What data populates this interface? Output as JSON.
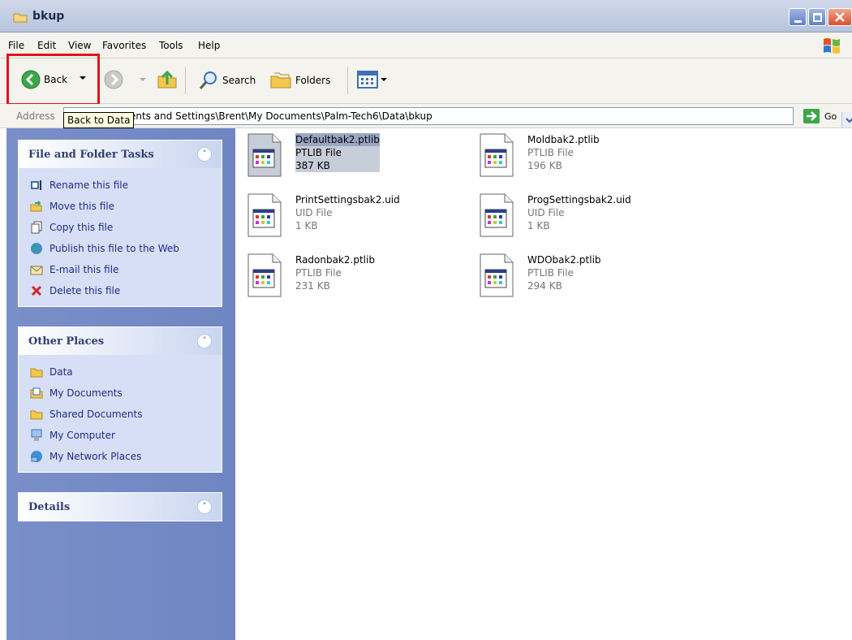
{
  "window": {
    "title": "bkup"
  },
  "menu": [
    "File",
    "Edit",
    "View",
    "Favorites",
    "Tools",
    "Help"
  ],
  "toolbar": {
    "back_label": "Back",
    "search_label": "Search",
    "folders_label": "Folders",
    "tooltip": "Back to Data"
  },
  "address": {
    "label": "Address",
    "value": "ents and Settings\\Brent\\My Documents\\Palm-Tech6\\Data\\bkup",
    "go_label": "Go"
  },
  "panels": {
    "file_tasks": {
      "title": "File and Folder Tasks",
      "items": [
        {
          "label": "Rename this file",
          "icon": "rename-icon"
        },
        {
          "label": "Move this file",
          "icon": "move-icon"
        },
        {
          "label": "Copy this file",
          "icon": "copy-icon"
        },
        {
          "label": "Publish this file to the Web",
          "icon": "globe-icon"
        },
        {
          "label": "E-mail this file",
          "icon": "email-icon"
        },
        {
          "label": "Delete this file",
          "icon": "delete-icon"
        }
      ]
    },
    "other_places": {
      "title": "Other Places",
      "items": [
        {
          "label": "Data",
          "icon": "folder-icon"
        },
        {
          "label": "My Documents",
          "icon": "documents-folder-icon"
        },
        {
          "label": "Shared Documents",
          "icon": "folder-icon"
        },
        {
          "label": "My Computer",
          "icon": "computer-icon"
        },
        {
          "label": "My Network Places",
          "icon": "network-icon"
        }
      ]
    },
    "details": {
      "title": "Details"
    }
  },
  "files": [
    {
      "name": "Defaultbak2.ptlib",
      "type": "PTLIB File",
      "size": "387 KB",
      "selected": true
    },
    {
      "name": "Moldbak2.ptlib",
      "type": "PTLIB File",
      "size": "196 KB",
      "selected": false
    },
    {
      "name": "PrintSettingsbak2.uid",
      "type": "UID File",
      "size": "1 KB",
      "selected": false
    },
    {
      "name": "ProgSettingsbak2.uid",
      "type": "UID File",
      "size": "1 KB",
      "selected": false
    },
    {
      "name": "Radonbak2.ptlib",
      "type": "PTLIB File",
      "size": "231 KB",
      "selected": false
    },
    {
      "name": "WDObak2.ptlib",
      "type": "PTLIB File",
      "size": "294 KB",
      "selected": false
    }
  ],
  "colors": {
    "highlight": "#e0141a",
    "task_link": "#1f2b8a",
    "pane": "#7a8fc8"
  }
}
